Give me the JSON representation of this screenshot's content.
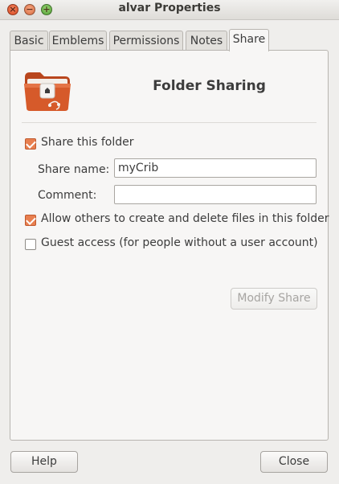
{
  "window": {
    "title": "alvar Properties",
    "controls": {
      "close": "×",
      "minimize": "−",
      "maximize": "+"
    }
  },
  "tabs": [
    {
      "label": "Basic"
    },
    {
      "label": "Emblems"
    },
    {
      "label": "Permissions"
    },
    {
      "label": "Notes"
    },
    {
      "label": "Share",
      "active": true
    }
  ],
  "share": {
    "icon": "folder-share-icon",
    "heading": "Folder Sharing",
    "share_this_folder": {
      "label": "Share this folder",
      "checked": true
    },
    "share_name": {
      "label": "Share name:",
      "value": "myCrib"
    },
    "comment": {
      "label": "Comment:",
      "value": ""
    },
    "allow_others": {
      "label": "Allow others to create and delete files in this folder",
      "checked": true
    },
    "guest_access": {
      "label": "Guest access (for people without a user account)",
      "checked": false
    },
    "modify_button": {
      "label": "Modify Share",
      "enabled": false
    }
  },
  "footer": {
    "help_label": "Help",
    "close_label": "Close"
  },
  "colors": {
    "accent": "#e87f4f",
    "folder": "#d65a2a",
    "background": "#efeeec"
  }
}
